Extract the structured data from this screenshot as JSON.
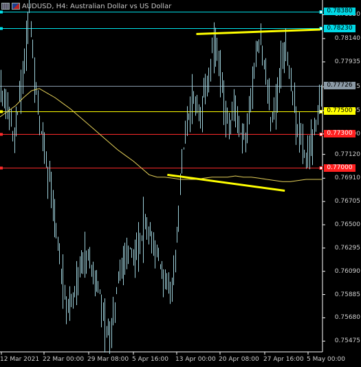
{
  "title": {
    "symbol_text": "AUDUSD, H4:  Australian Dollar vs US Dollar",
    "icons": [
      "chart-grid-icon",
      "currency-flag-icon"
    ]
  },
  "colors": {
    "background": "#000000",
    "candles": "#9fd2dc",
    "ma_line": "#e8d35a",
    "trendline": "#ffff00",
    "cyan_level": "#00e5ee",
    "yellow_level": "#ffff00",
    "red_level": "#ff2b2b",
    "gray_level": "#8899aa"
  },
  "price_labels": [
    {
      "text": "0.78380",
      "style": "cyan",
      "price": 0.7838
    },
    {
      "text": "0.78230",
      "style": "cyan",
      "price": 0.7823
    },
    {
      "text": "0.77726",
      "style": "gray",
      "price": 0.77726
    },
    {
      "text": "0.77500",
      "style": "yellow",
      "price": 0.775
    },
    {
      "text": "0.77300",
      "style": "red",
      "price": 0.773
    },
    {
      "text": "0.77000",
      "style": "red",
      "price": 0.77
    }
  ],
  "chart_data": {
    "type": "line",
    "title": "AUDUSD, H4:  Australian Dollar vs US Dollar",
    "x_labels": [
      "12 Mar 2021",
      "22 Mar 00:00",
      "29 Mar 08:00",
      "5 Apr 16:00",
      "13 Apr 00:00",
      "20 Apr 08:00",
      "27 Apr 16:00",
      "5 May 00:00"
    ],
    "y_ticks": [
      "0.78350",
      "0.78140",
      "0.77935",
      "0.77715",
      "0.77505",
      "0.77300",
      "0.77120",
      "0.76910",
      "0.76705",
      "0.76500",
      "0.76295",
      "0.76090",
      "0.75885",
      "0.75680",
      "0.75475"
    ],
    "ylim": [
      0.7538,
      0.7848
    ],
    "series": [
      {
        "values": [
          0.7765,
          0.7745,
          0.7725,
          0.776,
          0.779,
          0.7845,
          0.778,
          0.774,
          0.7715,
          0.769,
          0.766,
          0.762,
          0.759,
          0.7575,
          0.7595,
          0.761,
          0.7625,
          0.7618,
          0.7605,
          0.759,
          0.7565,
          0.755,
          0.758,
          0.761,
          0.7625,
          0.763,
          0.762,
          0.7635,
          0.765,
          0.764,
          0.7625,
          0.7615,
          0.76,
          0.7595,
          0.762,
          0.769,
          0.773,
          0.7755,
          0.776,
          0.775,
          0.777,
          0.7795,
          0.7815,
          0.778,
          0.7745,
          0.7735,
          0.776,
          0.773,
          0.7725,
          0.776,
          0.78,
          0.781,
          0.778,
          0.774,
          0.7755,
          0.7795,
          0.7805,
          0.777,
          0.774,
          0.7725,
          0.7705,
          0.772,
          0.774,
          0.776
        ]
      },
      {
        "values": [
          0.7745,
          0.775,
          0.7755,
          0.7762,
          0.7768,
          0.777,
          0.7766,
          0.7762,
          0.7757,
          0.7752,
          0.7746,
          0.774,
          0.7734,
          0.7728,
          0.7722,
          0.7716,
          0.7711,
          0.7706,
          0.77,
          0.7694,
          0.7692,
          0.7692,
          0.7691,
          0.769,
          0.769,
          0.769,
          0.7691,
          0.7692,
          0.7692,
          0.7692,
          0.7693,
          0.7692,
          0.7692,
          0.7691,
          0.769,
          0.7689,
          0.7688,
          0.7688,
          0.7689,
          0.769,
          0.769,
          0.769
        ]
      }
    ],
    "trendlines": [
      {
        "from": [
          0.61,
          0.7818
        ],
        "to": [
          0.995,
          0.7822
        ]
      },
      {
        "from": [
          0.52,
          0.7694
        ],
        "to": [
          0.885,
          0.768
        ]
      }
    ],
    "xlabel": "",
    "ylabel": "",
    "grid": false
  }
}
